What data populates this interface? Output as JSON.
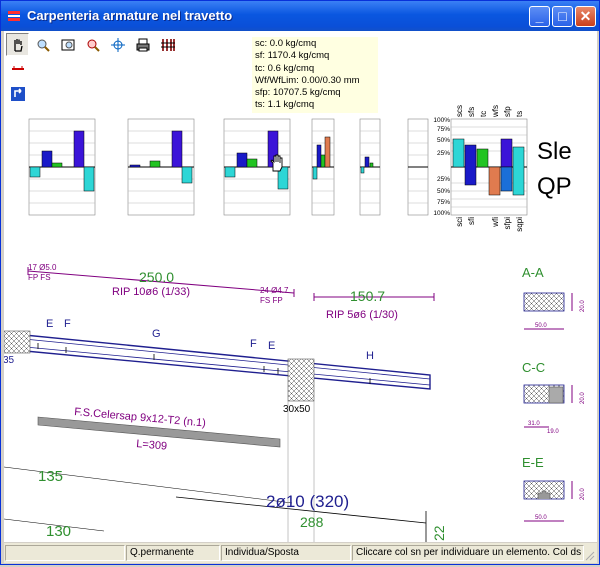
{
  "window": {
    "title": "Carpenteria armature nel travetto"
  },
  "toolbar": {
    "tools": [
      {
        "name": "hand-tool-button",
        "icon": "hand-icon"
      },
      {
        "name": "zoom-tool-button",
        "icon": "zoom-icon"
      },
      {
        "name": "zoom-window-button",
        "icon": "zoom-window-icon"
      },
      {
        "name": "zoom-extents-button",
        "icon": "zoom-extents-icon"
      },
      {
        "name": "crosshair-button",
        "icon": "crosshair-icon"
      },
      {
        "name": "print-button",
        "icon": "printer-icon"
      },
      {
        "name": "bars-button",
        "icon": "bars-icon"
      }
    ]
  },
  "info_box": {
    "lines": [
      "sc: 0.0 kg/cmq",
      "sf: 1170.4 kg/cmq",
      "tc: 0.6 kg/cmq",
      "Wf/WfLim: 0.00/0.30 mm",
      "sfp: 10707.5 kg/cmq",
      "ts: 1.1 kg/cmq"
    ]
  },
  "check_chart": {
    "pct_top": [
      "100%",
      "75%",
      "50%",
      "25%"
    ],
    "pct_bottom": [
      "25%",
      "50%",
      "75%",
      "100%"
    ],
    "top_labels": [
      "scs",
      "sfs",
      "tc",
      "wfs",
      "sfp",
      "ts"
    ],
    "bottom_labels": [
      "sci",
      "sfi",
      "wfi",
      "sfpi",
      "sqpi"
    ],
    "combo_label_line1": "Sle",
    "combo_label_line2": "QP"
  },
  "drawing": {
    "left_rebar": "17 Ø5.0",
    "left_rebar_sub": "FP FS",
    "dim_250": "250.0",
    "rip_1": "RIP 10ø6 (1/33)",
    "right_rebar": "24 Ø4.7",
    "right_rebar_sub": "FS FP",
    "dim_150": "150.7",
    "rip_2": "RIP 5ø6 (1/30)",
    "letters": [
      "E",
      "F",
      "G",
      "F",
      "E",
      "H"
    ],
    "edge_num": "35",
    "col_label": "30x50",
    "beam_name": "F.S.Celersap 9x12-T2 (n.1)",
    "beam_len": "L=309",
    "n135": "135",
    "n130": "130",
    "bar_label": "2ø10 (320)",
    "n288": "288",
    "n22": "22",
    "sections": [
      {
        "title": "A-A",
        "dim_w": "50.0",
        "dim_h": "20.0",
        "extra": ""
      },
      {
        "title": "C-C",
        "dim_w": "31.0",
        "dim_h": "20.0",
        "extra": "19.0"
      },
      {
        "title": "E-E",
        "dim_w": "50.0",
        "dim_h": "20.0",
        "extra": ""
      }
    ]
  },
  "status": {
    "cells": [
      "",
      "Q.permanente",
      "Individua/Sposta",
      "Cliccare col sn per individuare un elemento. Col ds"
    ]
  },
  "colors": {
    "title_blue": "#0a57e0",
    "bar_blue": "#1a1ac8",
    "bar_green": "#22c422",
    "bar_purple": "#3b14d8",
    "bar_cyan": "#2dd6d6",
    "bar_orange": "#e07b4f",
    "drawing_purple": "#800080",
    "drawing_green": "#2f8f2f",
    "drawing_navy": "#1f1f8f"
  }
}
